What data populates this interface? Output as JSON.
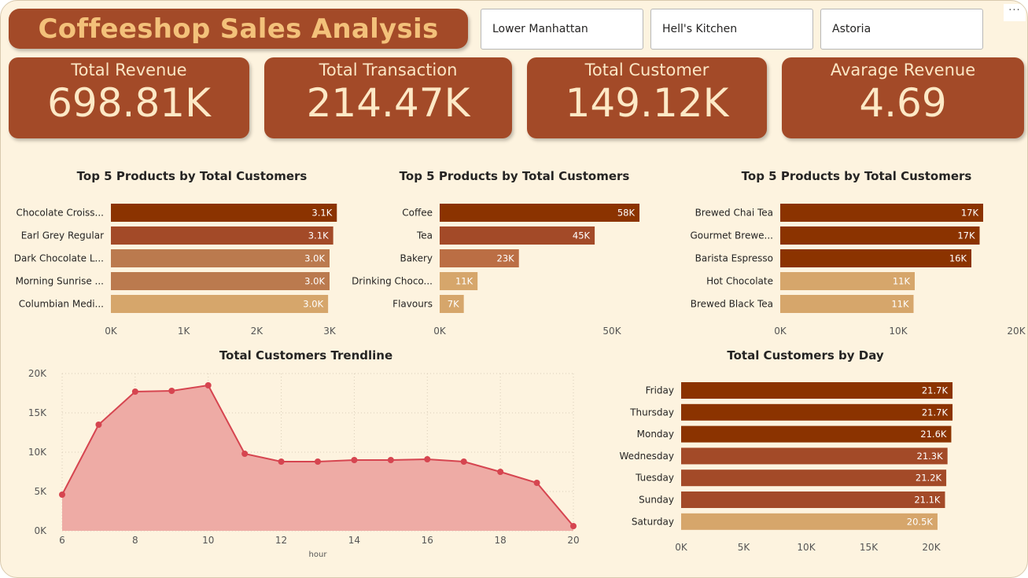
{
  "header": {
    "title": "Coffeeshop Sales Analysis"
  },
  "slicers": [
    "Lower Manhattan",
    "Hell's Kitchen",
    "Astoria"
  ],
  "more_options": "···",
  "kpis": [
    {
      "label": "Total Revenue",
      "value": "698.81K"
    },
    {
      "label": "Total Transaction",
      "value": "214.47K"
    },
    {
      "label": "Total Customer",
      "value": "149.12K"
    },
    {
      "label": "Avarage Revenue",
      "value": "4.69"
    }
  ],
  "colors": {
    "dark": "#8b3300",
    "medium": "#a34a28",
    "light": "#bb7a4e",
    "lightest": "#d6a66b",
    "line": "#d64550",
    "area": "#eeaba5"
  },
  "chart_data": [
    {
      "type": "bar",
      "orientation": "horizontal",
      "title": "Top 5 Products by Total Customers",
      "categories": [
        "Chocolate Croiss...",
        "Earl Grey Regular",
        "Dark Chocolate L...",
        "Morning Sunrise ...",
        "Columbian Medi..."
      ],
      "values": [
        3100,
        3050,
        3000,
        3000,
        2980
      ],
      "data_labels": [
        "3.1K",
        "3.1K",
        "3.0K",
        "3.0K",
        "3.0K"
      ],
      "bar_colors": [
        "#8b3300",
        "#a34a28",
        "#bb7a4e",
        "#bb7a4e",
        "#d6a66b"
      ],
      "xlim": [
        0,
        3000
      ],
      "xticks": [
        0,
        1000,
        2000,
        3000
      ],
      "xtick_labels": [
        "0K",
        "1K",
        "2K",
        "3K"
      ]
    },
    {
      "type": "bar",
      "orientation": "horizontal",
      "title": "Top 5 Products by Total Customers",
      "categories": [
        "Coffee",
        "Tea",
        "Bakery",
        "Drinking Choco...",
        "Flavours"
      ],
      "values": [
        58000,
        45000,
        23000,
        11000,
        7000
      ],
      "data_labels": [
        "58K",
        "45K",
        "23K",
        "11K",
        "7K"
      ],
      "bar_colors": [
        "#8b3300",
        "#a34a28",
        "#bb6e44",
        "#d6a66b",
        "#d6a66b"
      ],
      "xlim": [
        0,
        50000
      ],
      "xticks": [
        0,
        50000
      ],
      "xtick_labels": [
        "0K",
        "50K"
      ]
    },
    {
      "type": "bar",
      "orientation": "horizontal",
      "title": "Top 5 Products by Total Customers",
      "categories": [
        "Brewed Chai Tea",
        "Gourmet Brewe...",
        "Barista Espresso",
        "Hot Chocolate",
        "Brewed Black Tea"
      ],
      "values": [
        17200,
        16900,
        16200,
        11400,
        11300
      ],
      "data_labels": [
        "17K",
        "17K",
        "16K",
        "11K",
        "11K"
      ],
      "bar_colors": [
        "#8b3300",
        "#8b3300",
        "#8b3300",
        "#d6a66b",
        "#d6a66b"
      ],
      "xlim": [
        0,
        20000
      ],
      "xticks": [
        0,
        10000,
        20000
      ],
      "xtick_labels": [
        "0K",
        "10K",
        "20K"
      ]
    },
    {
      "type": "area",
      "title": "Total Customers Trendline",
      "xlabel": "hour",
      "x": [
        6,
        7,
        8,
        9,
        10,
        11,
        12,
        13,
        14,
        15,
        16,
        17,
        18,
        19,
        20
      ],
      "values": [
        4600,
        13500,
        17700,
        17800,
        18500,
        9800,
        8800,
        8800,
        9000,
        9000,
        9100,
        8800,
        7500,
        6100,
        600
      ],
      "xlim": [
        6,
        20
      ],
      "ylim": [
        0,
        20000
      ],
      "xticks": [
        6,
        8,
        10,
        12,
        14,
        16,
        18,
        20
      ],
      "xtick_labels": [
        "6",
        "8",
        "10",
        "12",
        "14",
        "16",
        "18",
        "20"
      ],
      "yticks": [
        0,
        5000,
        10000,
        15000,
        20000
      ],
      "ytick_labels": [
        "0K",
        "5K",
        "10K",
        "15K",
        "20K"
      ],
      "grid": true
    },
    {
      "type": "bar",
      "orientation": "horizontal",
      "title": "Total Customers by Day",
      "categories": [
        "Friday",
        "Thursday",
        "Monday",
        "Wednesday",
        "Tuesday",
        "Sunday",
        "Saturday"
      ],
      "values": [
        21700,
        21700,
        21600,
        21300,
        21200,
        21100,
        20500
      ],
      "data_labels": [
        "21.7K",
        "21.7K",
        "21.6K",
        "21.3K",
        "21.2K",
        "21.1K",
        "20.5K"
      ],
      "bar_colors": [
        "#8b3300",
        "#8b3300",
        "#8b3300",
        "#a34a28",
        "#a34a28",
        "#a34a28",
        "#d6a66b"
      ],
      "xlim": [
        0,
        20000
      ],
      "xticks": [
        0,
        5000,
        10000,
        15000,
        20000
      ],
      "xtick_labels": [
        "0K",
        "5K",
        "10K",
        "15K",
        "20K"
      ]
    }
  ]
}
